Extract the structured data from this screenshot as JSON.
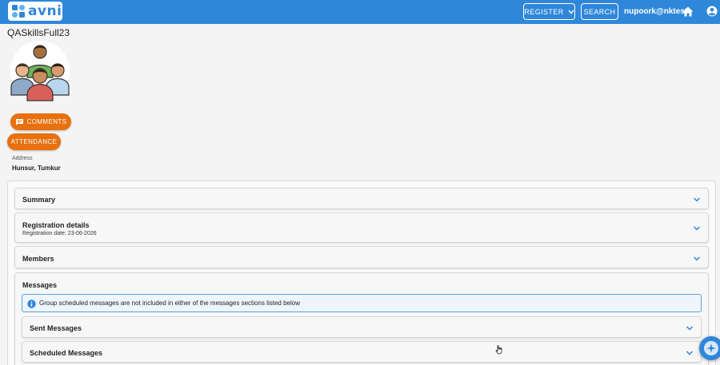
{
  "header": {
    "logo_text": "avni",
    "register_label": "REGISTER",
    "search_label": "SEARCH",
    "username": "nupoork@nktest"
  },
  "group": {
    "title": "QASkillsFull23",
    "comments_label": "COMMENTS",
    "attendance_label": "ATTENDANCE",
    "address_label": "Address",
    "address_value": "Hunsur, Tumkur"
  },
  "sections": {
    "summary_label": "Summary",
    "registration_label": "Registration details",
    "registration_date": "Registration date: 23-06-2026",
    "members_label": "Members",
    "messages_label": "Messages",
    "info_text": "Group scheduled messages are not included in either of the messages sections listed below",
    "sent_label": "Sent Messages",
    "scheduled_label": "Scheduled Messages"
  },
  "colors": {
    "primary": "#2f87d9",
    "accent": "#e8700e"
  },
  "icons": [
    "avni-logo-icon",
    "chevron-down-icon",
    "home-icon",
    "account-icon",
    "group-avatar-icon",
    "comment-icon",
    "info-icon",
    "expand-icon",
    "cursor-icon",
    "assistant-fab-icon"
  ]
}
